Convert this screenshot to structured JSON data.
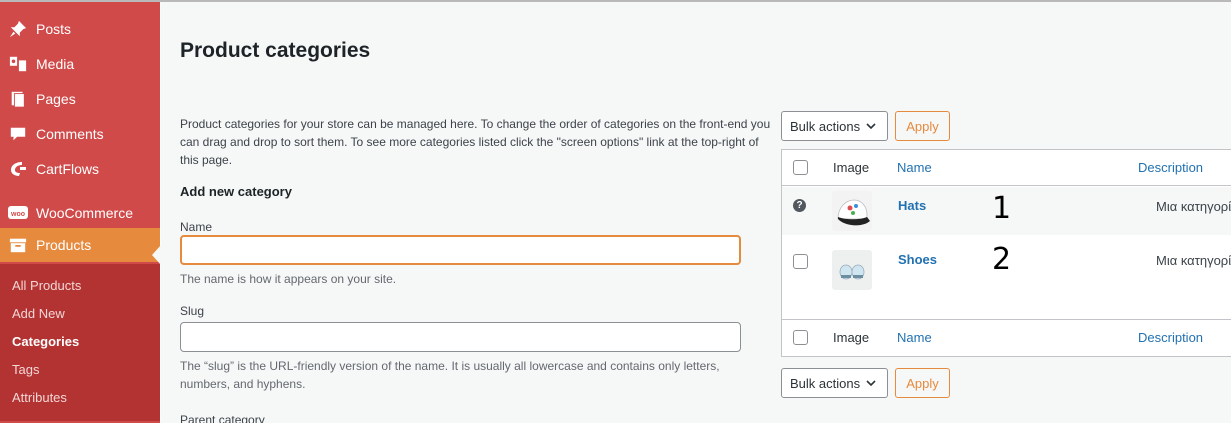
{
  "sidebar": {
    "items": [
      {
        "label": "Posts",
        "icon": "pin-icon"
      },
      {
        "label": "Media",
        "icon": "media-icon"
      },
      {
        "label": "Pages",
        "icon": "pages-icon"
      },
      {
        "label": "Comments",
        "icon": "comment-icon"
      },
      {
        "label": "CartFlows",
        "icon": "cartflows-icon"
      },
      {
        "label": "WooCommerce",
        "icon": "woocommerce-icon"
      },
      {
        "label": "Products",
        "icon": "archive-icon"
      }
    ],
    "submenu": [
      "All Products",
      "Add New",
      "Categories",
      "Tags",
      "Attributes"
    ],
    "current_sub": "Categories",
    "colors": {
      "menu_bg": "#d04a4a",
      "active_bg": "#e68a3e",
      "submenu_bg": "#b33333"
    }
  },
  "main": {
    "title": "Product categories",
    "description": "Product categories for your store can be managed here. To change the order of categories on the front-end you can drag and drop to sort them. To see more categories listed click the \"screen options\" link at the top-right of this page.",
    "form": {
      "heading": "Add new category",
      "name_label": "Name",
      "name_value": "",
      "name_help": "The name is how it appears on your site.",
      "slug_label": "Slug",
      "slug_value": "",
      "slug_help": "The “slug” is the URL-friendly version of the name. It is usually all lowercase and contains only letters, numbers, and hyphens.",
      "parent_label": "Parent category"
    },
    "bulk": {
      "select_label": "Bulk actions",
      "apply_label": "Apply"
    },
    "table": {
      "columns": [
        "Image",
        "Name",
        "Description"
      ],
      "rows": [
        {
          "name": "Hats",
          "description": "Μια κατηγορία",
          "annotation": "1"
        },
        {
          "name": "Shoes",
          "description": "Μια κατηγορία",
          "annotation": "2"
        }
      ]
    }
  }
}
